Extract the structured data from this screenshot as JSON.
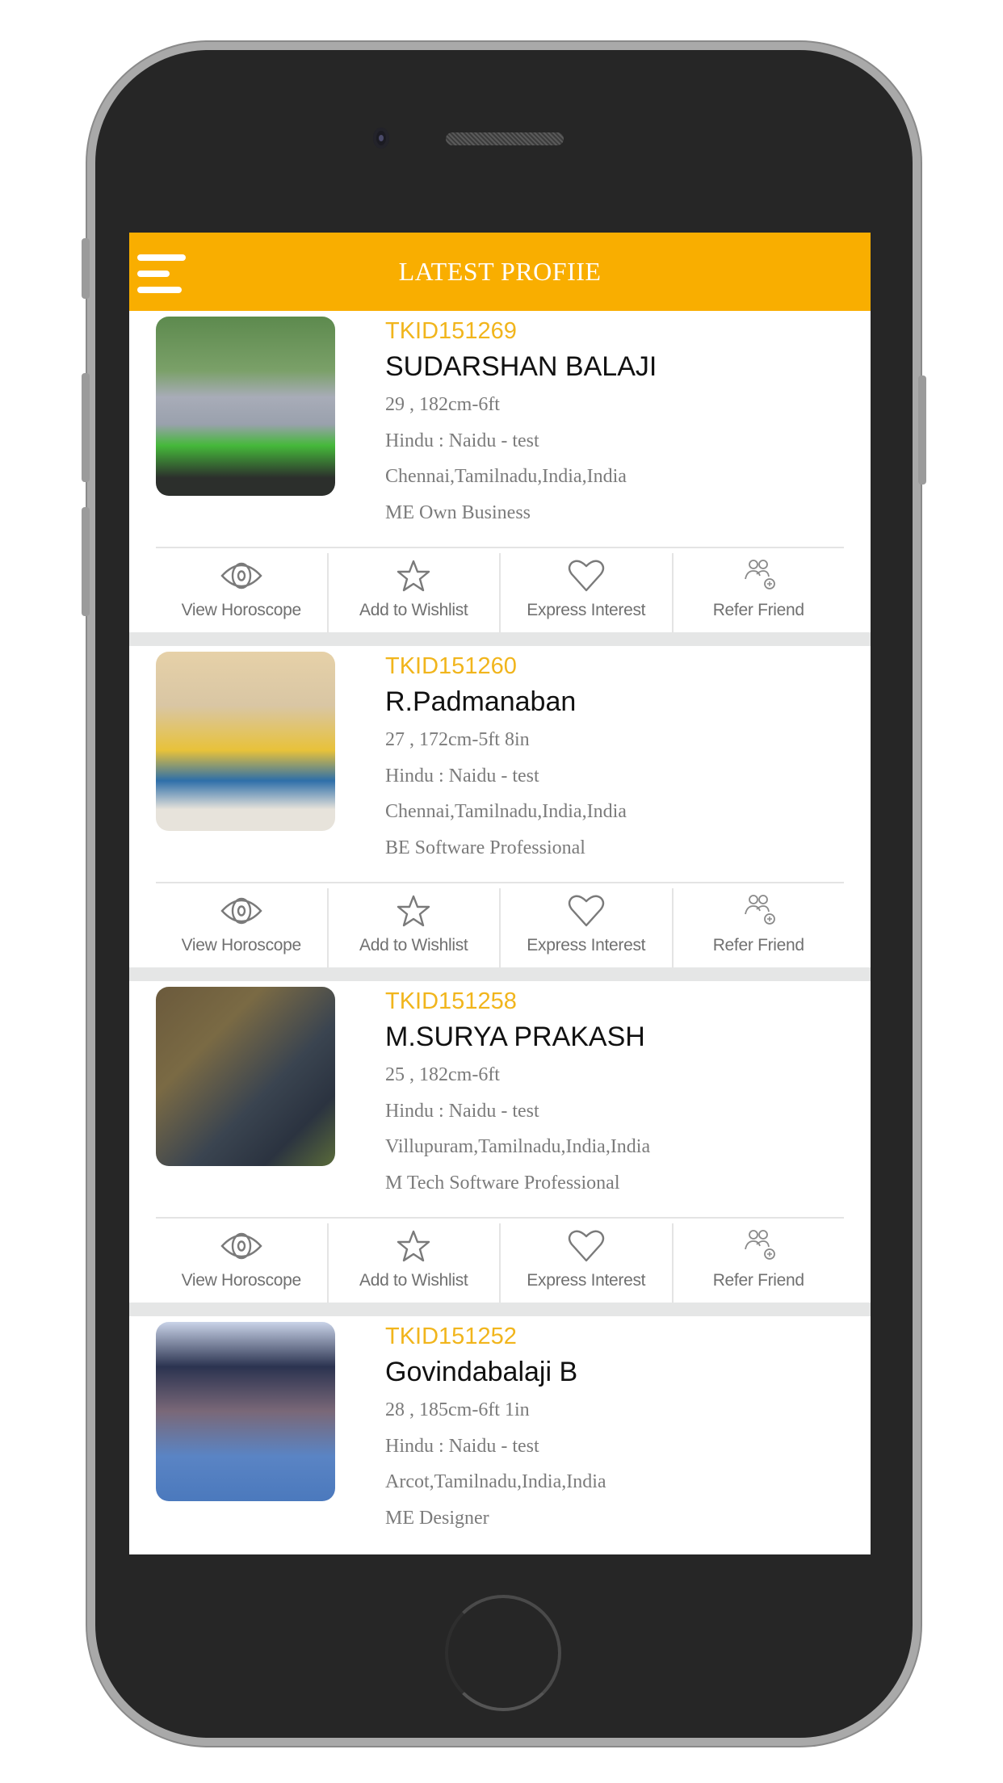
{
  "header": {
    "title": "LATEST PROFIIE",
    "menu_icon": "hamburger-menu-icon",
    "background_color": "#F9AE00"
  },
  "accent_color": "#F1B51C",
  "actions": [
    {
      "label": "View Horoscope",
      "icon": "eye-icon"
    },
    {
      "label": "Add to Wishlist",
      "icon": "star-icon"
    },
    {
      "label": "Express Interest",
      "icon": "heart-icon"
    },
    {
      "label": "Refer Friend",
      "icon": "refer-friend-icon"
    }
  ],
  "profiles": [
    {
      "id": "TKID151269",
      "name": "SUDARSHAN BALAJI",
      "age_height": "29 , 182cm-6ft",
      "religion": "Hindu : Naidu - test",
      "location": "Chennai,Tamilnadu,India,India",
      "education_occupation": "ME Own Business",
      "photo": "man-with-green-motorbike-photo"
    },
    {
      "id": "TKID151260",
      "name": "R.Padmanaban",
      "age_height": "27 , 172cm-5ft 8in",
      "religion": "Hindu : Naidu - test",
      "location": "Chennai,Tamilnadu,India,India",
      "education_occupation": "BE Software Professional",
      "photo": "man-in-striped-shirt-photo"
    },
    {
      "id": "TKID151258",
      "name": "M.SURYA PRAKASH",
      "age_height": "25 , 182cm-6ft",
      "religion": "Hindu : Naidu - test",
      "location": "Villupuram,Tamilnadu,India,India",
      "education_occupation": "M Tech Software Professional",
      "photo": "man-with-glasses-outdoor-photo"
    },
    {
      "id": "TKID151252",
      "name": "Govindabalaji B",
      "age_height": "28 , 185cm-6ft 1in",
      "religion": "Hindu : Naidu - test",
      "location": "Arcot,Tamilnadu,India,India",
      "education_occupation": "ME Designer",
      "photo": "man-in-blue-shirt-photo"
    }
  ]
}
